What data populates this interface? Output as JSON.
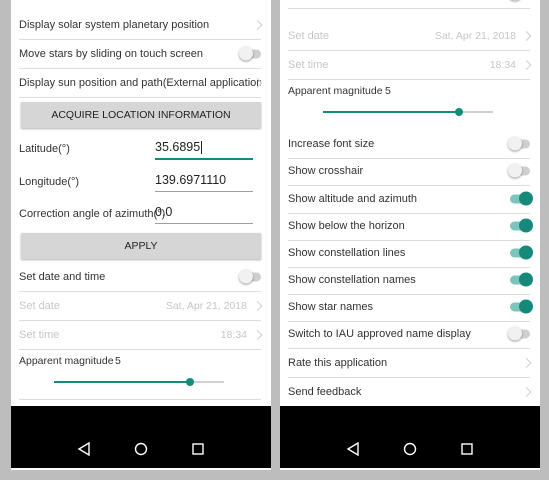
{
  "left": {
    "rows_top": [
      {
        "label": "Display solar system planetary position",
        "control": "chevron"
      },
      {
        "label": "Move stars by sliding on touch screen",
        "control": "toggle",
        "on": false
      },
      {
        "label": "Display sun position and path(External application)",
        "control": "chevron"
      }
    ],
    "acquire_button": "ACQUIRE LOCATION INFORMATION",
    "latitude_label": "Latitude(°)",
    "latitude_value": "35.6895",
    "longitude_label": "Longitude(°)",
    "longitude_value": "139.6971110",
    "azimuth_label": "Correction angle of azimuth(°)",
    "azimuth_value": "0.0",
    "apply_button": "APPLY",
    "set_date_time_label": "Set date and time",
    "set_date_label": "Set date",
    "set_date_value": "Sat, Apr 21, 2018",
    "set_time_label": "Set time",
    "set_time_value": "18:34",
    "magnitude_label": "Apparent magnitude",
    "magnitude_value": "5",
    "magnitude_fraction": 0.8
  },
  "right": {
    "set_date_label": "Set date",
    "set_date_value": "Sat, Apr 21, 2018",
    "set_time_label": "Set time",
    "set_time_value": "18:34",
    "magnitude_label": "Apparent magnitude",
    "magnitude_value": "5",
    "magnitude_fraction": 0.8,
    "settings": [
      {
        "label": "Increase font size",
        "on": false
      },
      {
        "label": "Show crosshair",
        "on": false
      },
      {
        "label": "Show altitude and azimuth",
        "on": true
      },
      {
        "label": "Show below the horizon",
        "on": true
      },
      {
        "label": "Show constellation lines",
        "on": true
      },
      {
        "label": "Show constellation names",
        "on": true
      },
      {
        "label": "Show star names",
        "on": true
      },
      {
        "label": "Switch to IAU approved name display",
        "on": false
      }
    ],
    "rate_label": "Rate this application",
    "feedback_label": "Send feedback"
  },
  "colors": {
    "accent": "#148c7c",
    "navbar": "#000000",
    "background": "#bdbdbd"
  },
  "icons": {
    "back": "back-triangle-icon",
    "home": "home-circle-icon",
    "recent": "recent-square-icon"
  }
}
